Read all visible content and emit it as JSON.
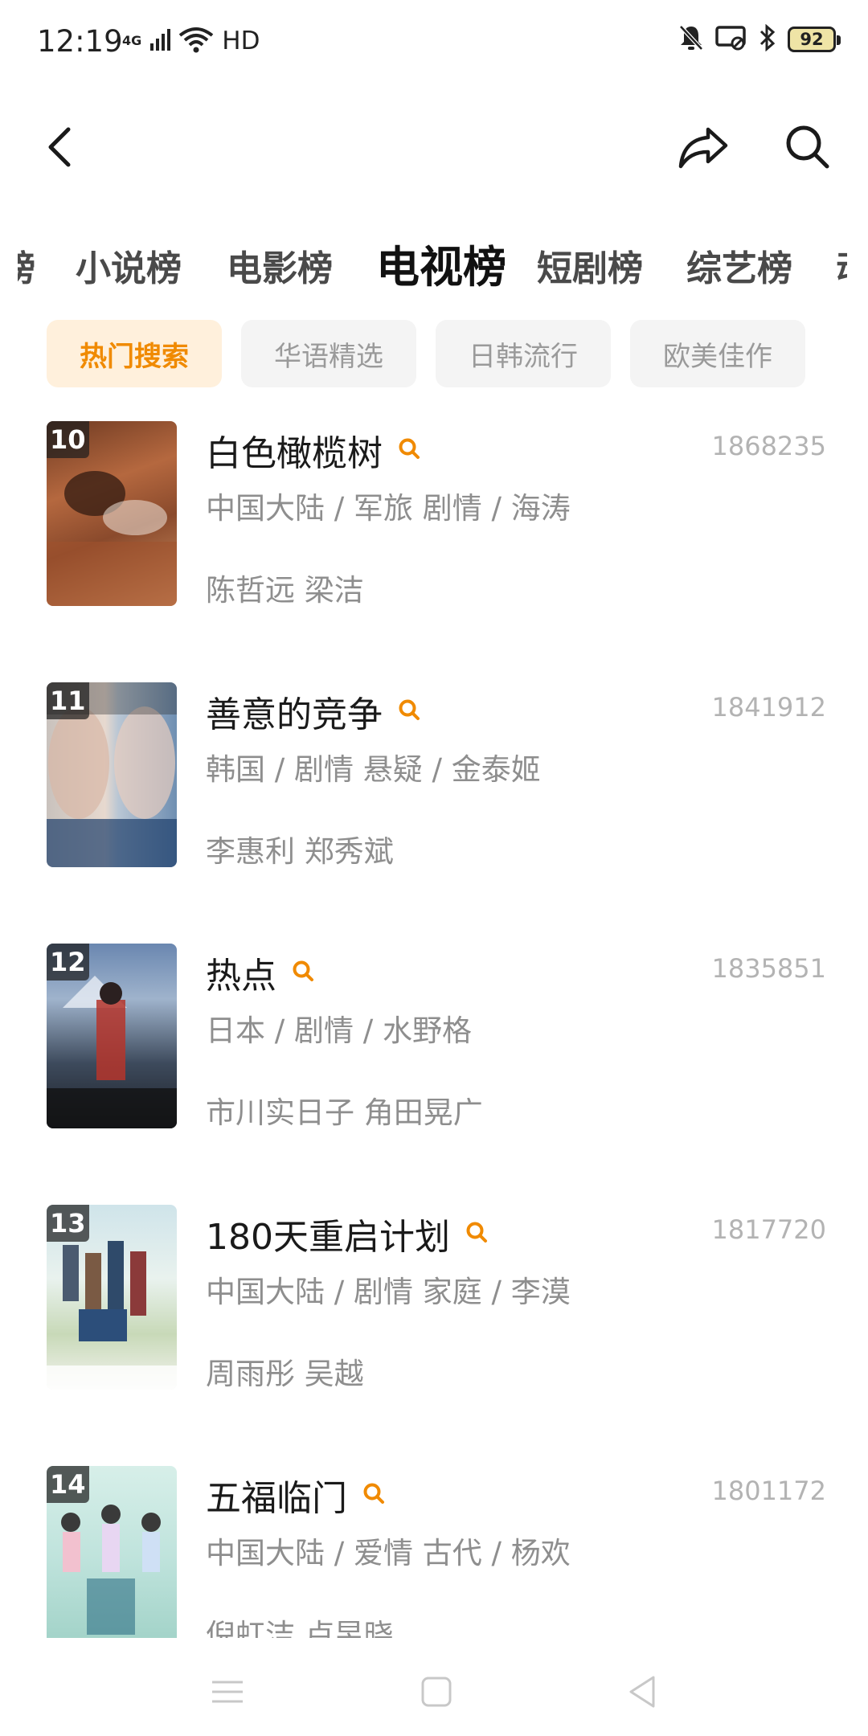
{
  "status_bar": {
    "time": "12:19",
    "network_label": "4G",
    "hd_label": "HD",
    "battery": "92",
    "icons": [
      "signal-icon",
      "wifi-icon",
      "bell-muted-icon",
      "cast-icon",
      "bluetooth-icon",
      "battery-icon"
    ]
  },
  "header": {
    "back_icon": "back-icon",
    "share_icon": "share-icon",
    "search_icon": "search-icon"
  },
  "category_tabs": {
    "items": [
      {
        "label": "小说榜",
        "active": false
      },
      {
        "label": "电影榜",
        "active": false
      },
      {
        "label": "电视榜",
        "active": true
      },
      {
        "label": "短剧榜",
        "active": false
      },
      {
        "label": "综艺榜",
        "active": false
      }
    ],
    "left_partial": "榜",
    "right_partial": "动"
  },
  "filter_chips": {
    "items": [
      {
        "label": "热门搜索",
        "active": true
      },
      {
        "label": "华语精选",
        "active": false
      },
      {
        "label": "日韩流行",
        "active": false
      },
      {
        "label": "欧美佳作",
        "active": false
      }
    ]
  },
  "accent_color": "#f08a00",
  "rankings": [
    {
      "rank": "10",
      "title": "白色橄榄树",
      "heat": "1868235",
      "meta": "中国大陆 / 军旅 剧情 / 海涛",
      "cast": "陈哲远 梁洁"
    },
    {
      "rank": "11",
      "title": "善意的竞争",
      "heat": "1841912",
      "meta": "韩国 / 剧情 悬疑 / 金泰姬",
      "cast": "李惠利 郑秀斌"
    },
    {
      "rank": "12",
      "title": "热点",
      "heat": "1835851",
      "meta": "日本 / 剧情 / 水野格",
      "cast": "市川实日子 角田晃广"
    },
    {
      "rank": "13",
      "title": "180天重启计划",
      "heat": "1817720",
      "meta": "中国大陆 / 剧情 家庭 / 李漠",
      "cast": "周雨彤 吴越"
    },
    {
      "rank": "14",
      "title": "五福临门",
      "heat": "1801172",
      "meta": "中国大陆 / 爱情 古代 / 杨欢",
      "cast": "倪虹洁 卢昱晓"
    }
  ],
  "nav_bar": {
    "icons": [
      "menu-icon",
      "home-icon",
      "back-triangle-icon"
    ]
  }
}
